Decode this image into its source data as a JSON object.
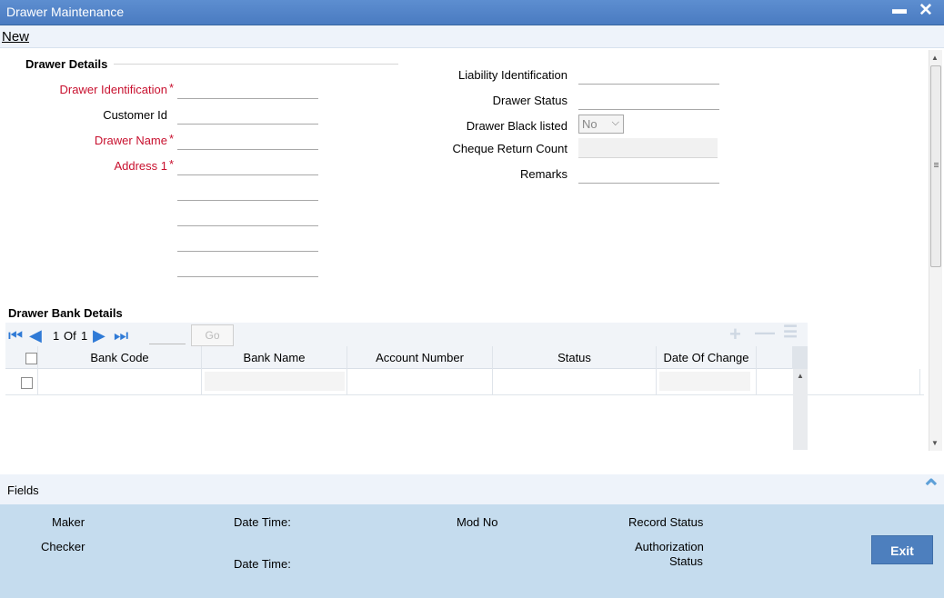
{
  "window": {
    "title": "Drawer Maintenance",
    "minimize_glyph": "▬",
    "close_glyph": "✕"
  },
  "toolbar": {
    "new_label": "New"
  },
  "drawer_details": {
    "section_title": "Drawer Details",
    "drawer_identification": {
      "label": "Drawer Identification",
      "required": "*",
      "value": ""
    },
    "customer_id": {
      "label": "Customer Id",
      "value": ""
    },
    "drawer_name": {
      "label": "Drawer Name",
      "required": "*",
      "value": ""
    },
    "address1": {
      "label": "Address 1",
      "required": "*",
      "value": ""
    },
    "liability_identification": {
      "label": "Liability Identification",
      "value": ""
    },
    "drawer_status": {
      "label": "Drawer Status",
      "value": ""
    },
    "drawer_black_listed": {
      "label": "Drawer Black listed",
      "value": "No"
    },
    "cheque_return_count": {
      "label": "Cheque Return Count",
      "value": ""
    },
    "remarks": {
      "label": "Remarks",
      "value": ""
    }
  },
  "bank_details": {
    "section_title": "Drawer Bank Details",
    "pager": {
      "current": "1",
      "of_label": "Of",
      "total": "1",
      "go_label": "Go"
    },
    "columns": [
      "Bank Code",
      "Bank Name",
      "Account Number",
      "Status",
      "Date Of Change"
    ]
  },
  "fields_bar": {
    "label": "Fields"
  },
  "audit": {
    "maker_label": "Maker",
    "checker_label": "Checker",
    "date_time_label_1": "Date Time:",
    "date_time_label_2": "Date Time:",
    "mod_no_label": "Mod No",
    "record_status_label": "Record Status",
    "authorization_label": "Authorization",
    "status_label": "Status",
    "exit_label": "Exit"
  },
  "colors": {
    "title_bar": "#4a7bc1",
    "required_label": "#c8102e",
    "footer": "#c5dcee",
    "exit_button": "#4d7fbe"
  },
  "icons": [
    "minimize-icon",
    "close-icon",
    "first-page-icon",
    "prev-page-icon",
    "next-page-icon",
    "last-page-icon",
    "add-row-icon",
    "delete-row-icon",
    "single-view-icon",
    "collapse-icon"
  ]
}
